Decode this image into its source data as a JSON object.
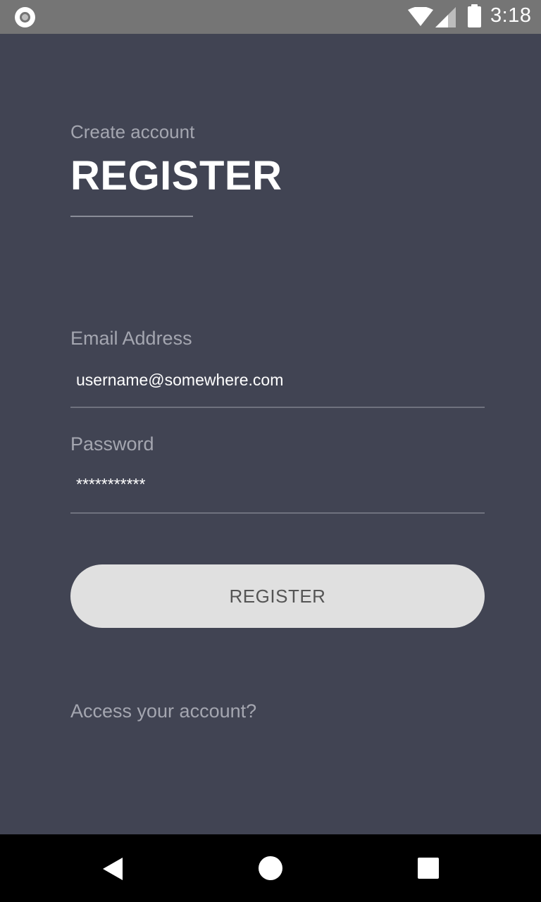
{
  "status_bar": {
    "time": "3:18",
    "left_icon": "notification-circle-icon",
    "wifi_icon": "wifi-icon",
    "signal_icon": "cell-signal-icon",
    "battery_icon": "battery-icon"
  },
  "header": {
    "subtitle": "Create account",
    "title": "REGISTER"
  },
  "form": {
    "email": {
      "label": "Email Address",
      "value": "username@somewhere.com"
    },
    "password": {
      "label": "Password",
      "value": "***********"
    },
    "submit_label": "REGISTER"
  },
  "footer": {
    "access_link": "Access your account?"
  },
  "nav_bar": {
    "back_icon": "back-triangle-icon",
    "home_icon": "home-circle-icon",
    "recent_icon": "recent-apps-square-icon"
  },
  "colors": {
    "background": "#414453",
    "status_bar": "#757575",
    "button": "#e0e0e0",
    "muted_text": "#a4a6b0"
  }
}
